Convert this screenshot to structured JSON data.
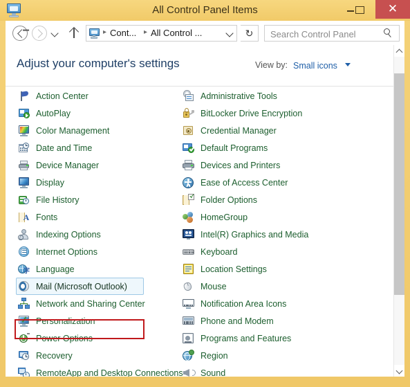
{
  "window": {
    "title": "All Control Panel Items",
    "app_icon": "control-panel-monitor-icon",
    "minimize_label": "Minimize",
    "maximize_label": "Maximize",
    "close_label": "Close",
    "close_glyph": "✕",
    "frame_color": "#f0c868"
  },
  "navbar": {
    "back_label": "Back",
    "forward_label": "Forward",
    "recent_label": "Recent locations",
    "up_label": "Up one level",
    "breadcrumb": {
      "separator": "▸",
      "items": [
        "Cont...",
        "All Control ..."
      ]
    },
    "refresh_glyph": "↻",
    "refresh_label": "Refresh",
    "search": {
      "placeholder": "Search Control Panel",
      "value": ""
    }
  },
  "header": {
    "page_title": "Adjust your computer's settings",
    "page_title_color": "#1f3f66",
    "view_by_label": "View by:",
    "view_by_value": "Small icons",
    "view_by_color": "#1f5fa8"
  },
  "list": {
    "item_text_color": "#1c5e2e",
    "left_column": [
      {
        "label": "Action Center",
        "icon": "flag-icon"
      },
      {
        "label": "AutoPlay",
        "icon": "autoplay-icon"
      },
      {
        "label": "Color Management",
        "icon": "color-monitor-icon"
      },
      {
        "label": "Date and Time",
        "icon": "calendar-clock-icon"
      },
      {
        "label": "Device Manager",
        "icon": "printer-device-icon"
      },
      {
        "label": "Display",
        "icon": "display-monitor-icon"
      },
      {
        "label": "File History",
        "icon": "file-history-icon"
      },
      {
        "label": "Fonts",
        "icon": "fonts-folder-icon"
      },
      {
        "label": "Indexing Options",
        "icon": "indexing-person-icon"
      },
      {
        "label": "Internet Options",
        "icon": "internet-globe-icon"
      },
      {
        "label": "Language",
        "icon": "language-globe-icon"
      },
      {
        "label": "Mail (Microsoft Outlook)",
        "icon": "mail-outlook-icon",
        "selected": true
      },
      {
        "label": "Network and Sharing Center",
        "icon": "network-sharing-icon"
      },
      {
        "label": "Personalization",
        "icon": "personalization-icon"
      },
      {
        "label": "Power Options",
        "icon": "power-plug-icon"
      },
      {
        "label": "Recovery",
        "icon": "recovery-clock-icon"
      },
      {
        "label": "RemoteApp and Desktop Connections",
        "icon": "remoteapp-icon"
      }
    ],
    "right_column": [
      {
        "label": "Administrative Tools",
        "icon": "admin-tools-icon"
      },
      {
        "label": "BitLocker Drive Encryption",
        "icon": "bitlocker-lock-icon"
      },
      {
        "label": "Credential Manager",
        "icon": "credential-manager-icon"
      },
      {
        "label": "Default Programs",
        "icon": "default-programs-icon"
      },
      {
        "label": "Devices and Printers",
        "icon": "printer-icon"
      },
      {
        "label": "Ease of Access Center",
        "icon": "ease-of-access-icon"
      },
      {
        "label": "Folder Options",
        "icon": "folder-options-icon"
      },
      {
        "label": "HomeGroup",
        "icon": "homegroup-icon"
      },
      {
        "label": "Intel(R) Graphics and Media",
        "icon": "intel-graphics-icon"
      },
      {
        "label": "Keyboard",
        "icon": "keyboard-icon"
      },
      {
        "label": "Location Settings",
        "icon": "location-settings-icon"
      },
      {
        "label": "Mouse",
        "icon": "mouse-icon"
      },
      {
        "label": "Notification Area Icons",
        "icon": "notification-area-icon"
      },
      {
        "label": "Phone and Modem",
        "icon": "phone-modem-icon"
      },
      {
        "label": "Programs and Features",
        "icon": "programs-features-icon"
      },
      {
        "label": "Region",
        "icon": "region-globe-icon"
      },
      {
        "label": "Sound",
        "icon": "sound-speaker-icon"
      }
    ]
  },
  "scrollbar": {
    "up_label": "Scroll up",
    "down_label": "Scroll down",
    "thumb_label": "Scroll thumb"
  },
  "annotation": {
    "color": "#c0191c",
    "target": "Mail (Microsoft Outlook)"
  }
}
